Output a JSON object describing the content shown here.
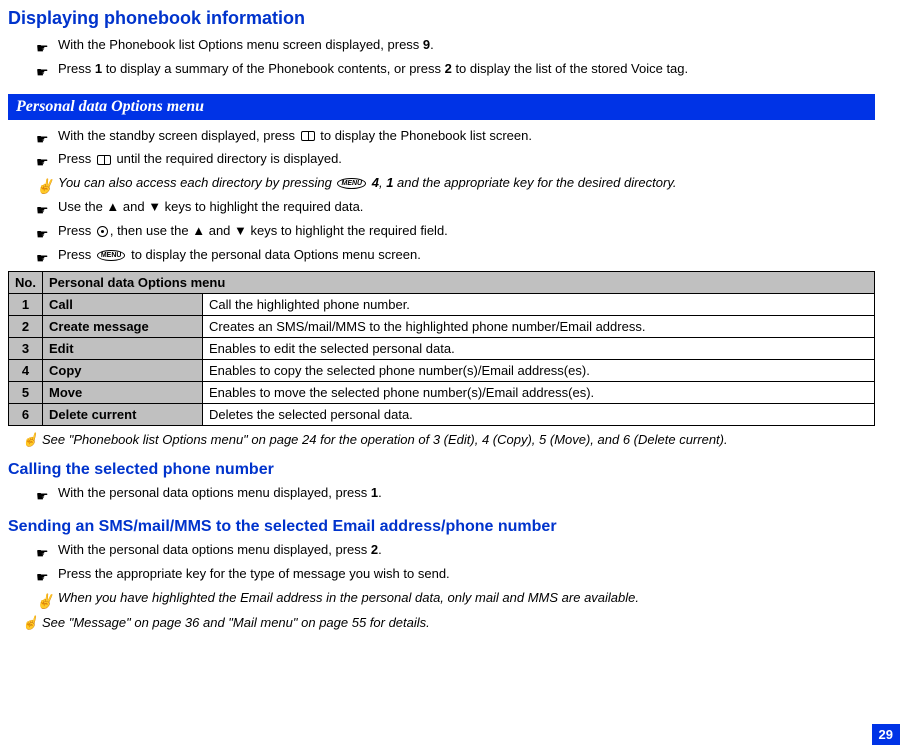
{
  "title1": "Displaying phonebook information",
  "section1": {
    "items": [
      {
        "icon": "☛",
        "text": "With the Phonebook list Options menu screen displayed, press ",
        "bold1": "9",
        "suffix": "."
      },
      {
        "icon": "☛",
        "text": "Press ",
        "bold1": "1",
        "mid1": " to display a summary of the Phonebook contents, or press ",
        "bold2": "2",
        "suffix": " to display the list of the stored Voice tag."
      }
    ]
  },
  "banner1": "Personal data Options menu",
  "section2": {
    "items": [
      {
        "icon": "☛",
        "pre": "With the standby screen displayed, press ",
        "iconmid": "book",
        "suffix": " to display the Phonebook list screen."
      },
      {
        "icon": "☛",
        "pre": "Press ",
        "iconmid": "book",
        "suffix": " until the required directory is displayed."
      },
      {
        "icon": "✌",
        "italic": true,
        "pre": "You can also access each directory by pressing ",
        "iconmid": "menu",
        "mid": " ",
        "bold1": "4",
        "mid2": ", ",
        "bold2": "1",
        "suffix": " and the appropriate key for the desired directory."
      },
      {
        "icon": "☛",
        "pre": "Use the ▲ and ▼ keys to highlight the required data."
      },
      {
        "icon": "☛",
        "pre": "Press ",
        "iconmid": "circle",
        "suffix": ", then use the ▲ and ▼ keys to highlight the required field."
      },
      {
        "icon": "☛",
        "pre": "Press ",
        "iconmid": "menu",
        "suffix": " to display the personal data Options menu screen."
      }
    ]
  },
  "table": {
    "headers": {
      "no": "No.",
      "menu": "Personal data Options menu"
    },
    "rows": [
      {
        "no": "1",
        "cmd": "Call",
        "desc": "Call the highlighted phone number."
      },
      {
        "no": "2",
        "cmd": "Create message",
        "desc": "Creates an SMS/mail/MMS to the highlighted phone number/Email address."
      },
      {
        "no": "3",
        "cmd": "Edit",
        "desc": "Enables to edit the selected personal data."
      },
      {
        "no": "4",
        "cmd": "Copy",
        "desc": "Enables to copy the selected phone number(s)/Email address(es)."
      },
      {
        "no": "5",
        "cmd": "Move",
        "desc": "Enables to move the selected phone number(s)/Email address(es)."
      },
      {
        "no": "6",
        "cmd": "Delete current",
        "desc": "Deletes the selected personal data."
      }
    ]
  },
  "crossref1": {
    "icon": "☝",
    "text": "See \"Phonebook list Options menu\" on page 24 for the operation of 3 (Edit), 4 (Copy), 5 (Move), and 6 (Delete current)."
  },
  "title2": "Calling the selected phone number",
  "section3": {
    "items": [
      {
        "icon": "☛",
        "text": "With the personal data options menu displayed, press ",
        "bold1": "1",
        "suffix": "."
      }
    ]
  },
  "title3": "Sending an SMS/mail/MMS to the selected Email address/phone number",
  "section4": {
    "items": [
      {
        "icon": "☛",
        "text": "With the personal data options menu displayed, press ",
        "bold1": "2",
        "suffix": "."
      },
      {
        "icon": "☛",
        "text": "Press the appropriate key for the type of message you wish to send."
      },
      {
        "icon": "✌",
        "italic": true,
        "text": "When you have highlighted the Email address in the personal data, only mail and MMS are available."
      }
    ]
  },
  "crossref2": {
    "icon": "☝",
    "text": "See \"Message\" on page 36 and \"Mail menu\" on page 55 for details."
  },
  "pageNumber": "29"
}
